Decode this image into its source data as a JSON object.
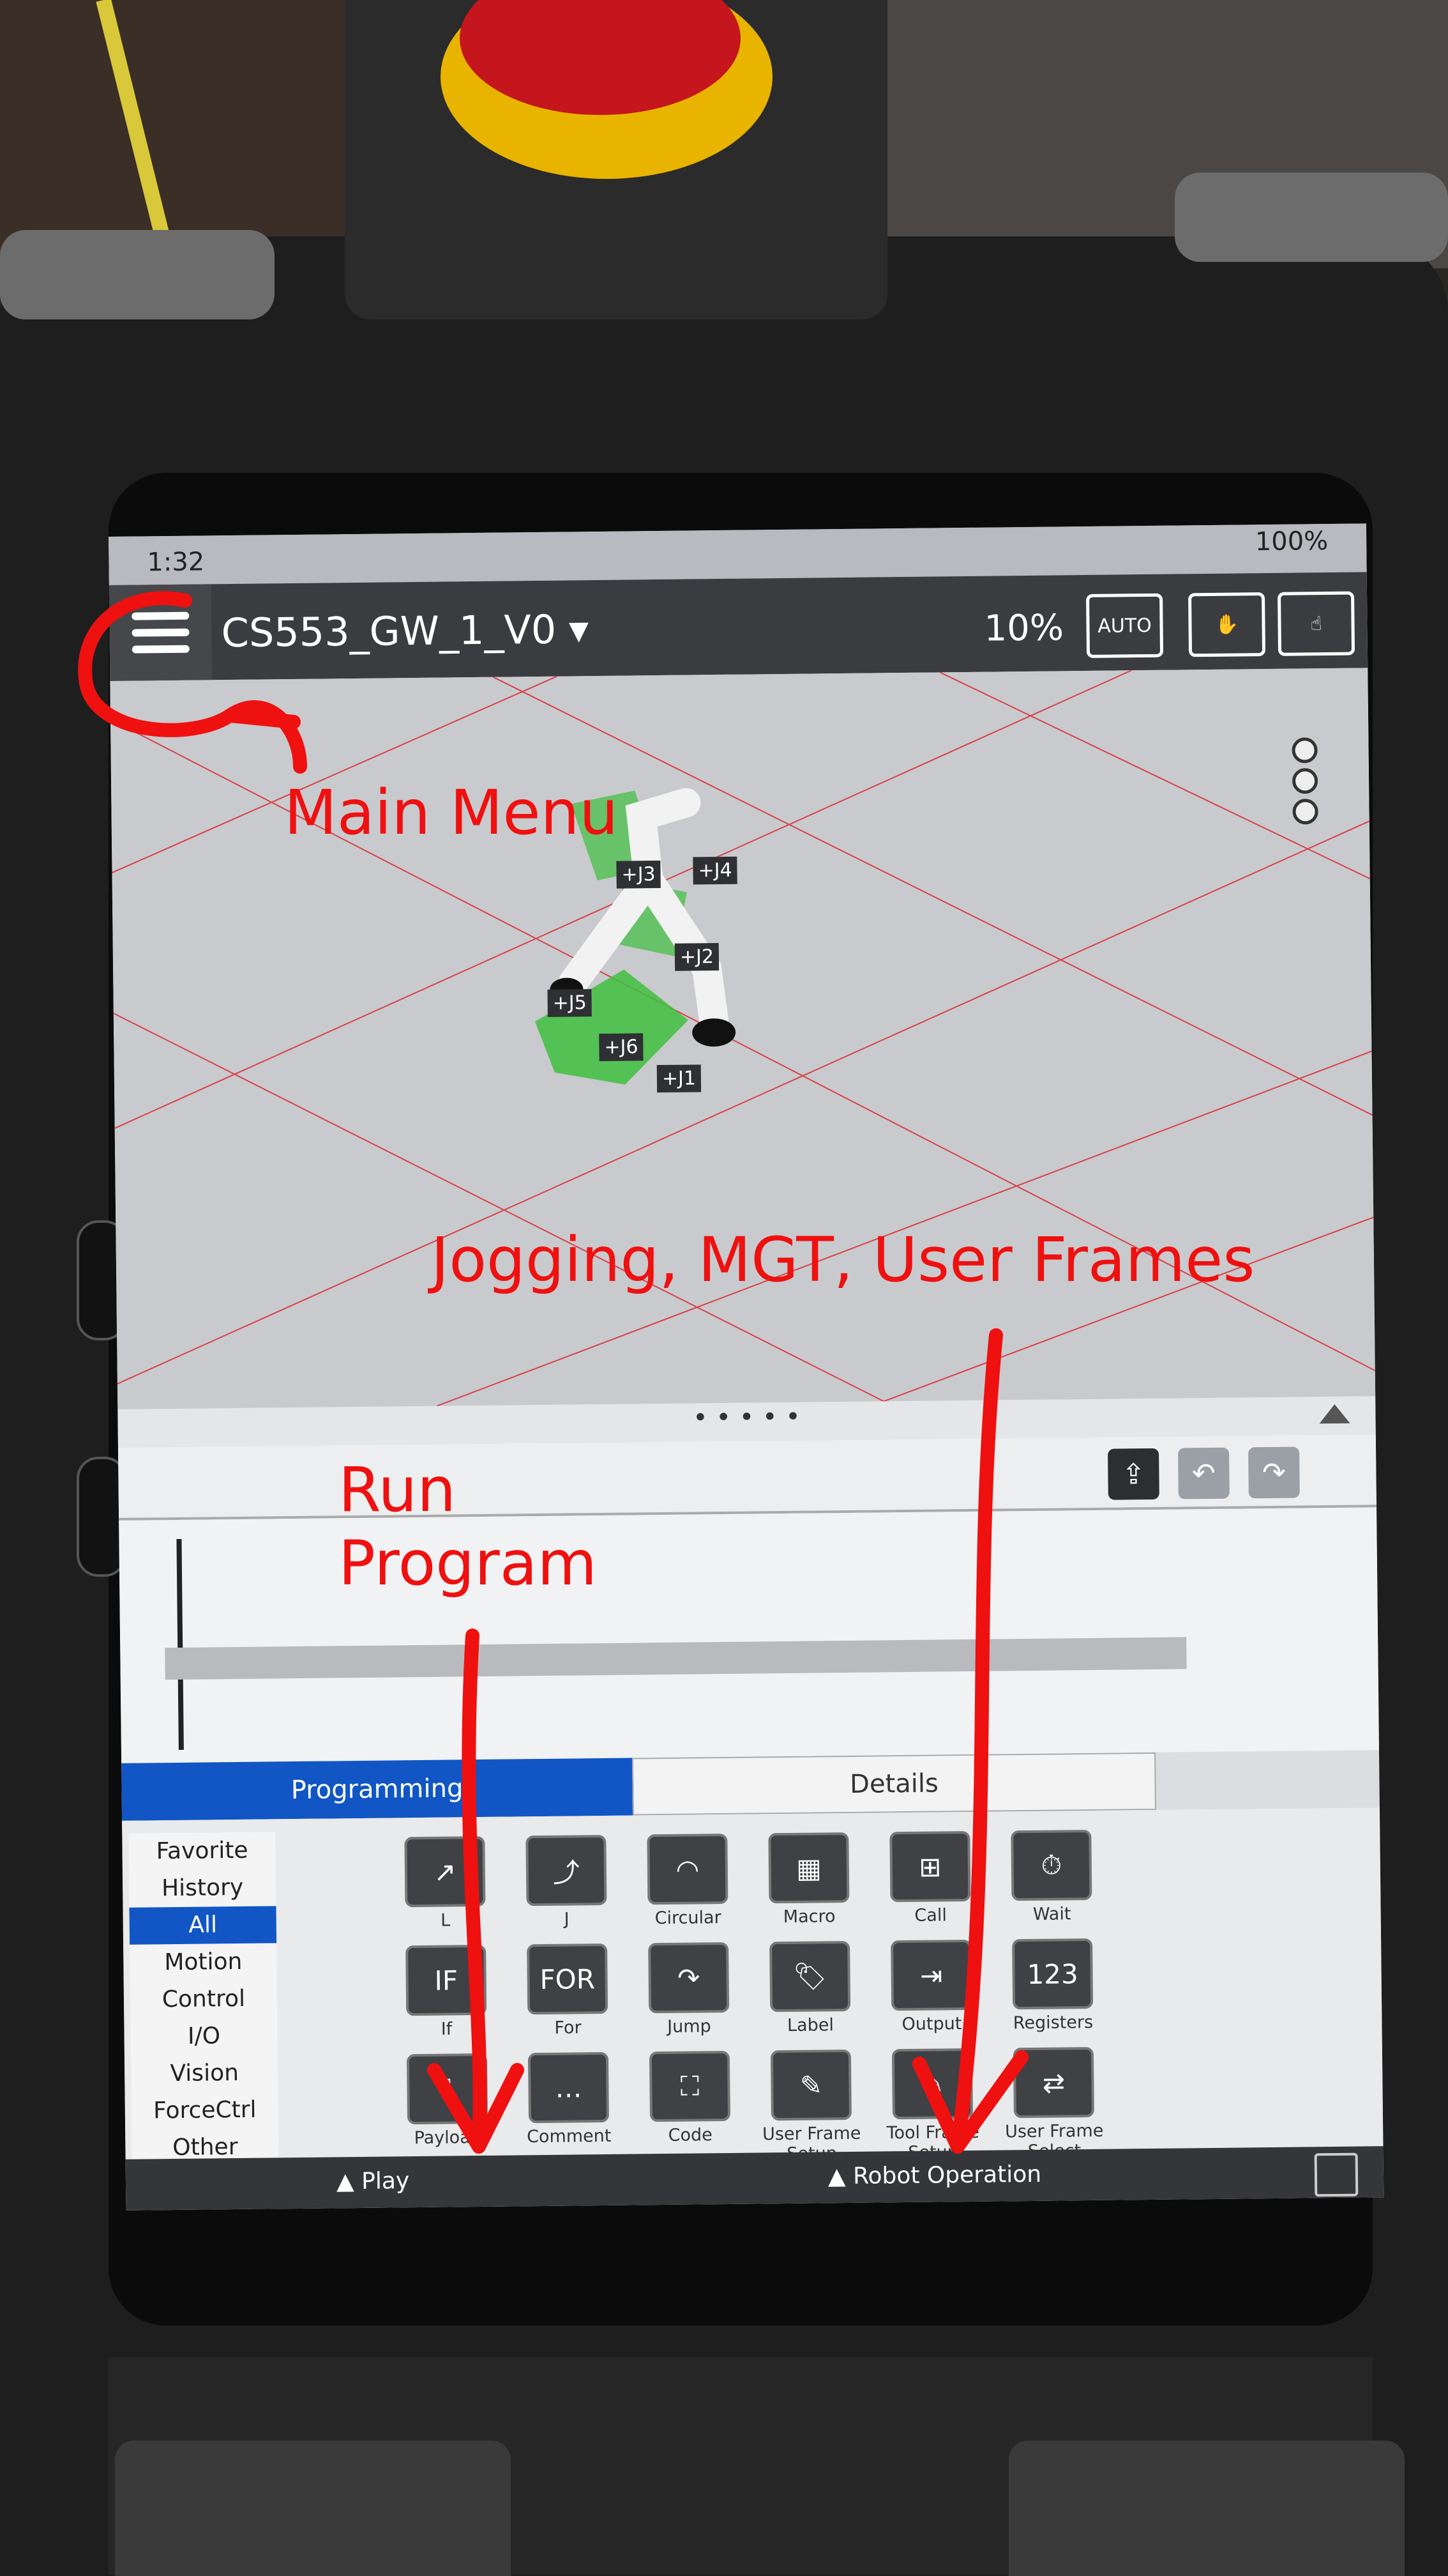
{
  "status_bar": {
    "time": "1:32",
    "battery": "100%"
  },
  "top_bar": {
    "program_title": "CS553_GW_1_V0",
    "speed": "10%",
    "auto_label": "AUTO"
  },
  "joint_labels": [
    "+J3",
    "+J4",
    "+J2",
    "+J5",
    "+J6",
    "+J1"
  ],
  "editor_tabs": {
    "programming": "Programming",
    "details": "Details"
  },
  "categories": [
    "Favorite",
    "History",
    "All",
    "Motion",
    "Control",
    "I/O",
    "Vision",
    "ForceCtrl",
    "Other"
  ],
  "commands": [
    {
      "label": "L",
      "icon": "linear-move-icon",
      "glyph": "↗"
    },
    {
      "label": "J",
      "icon": "joint-move-icon",
      "glyph": "⤴"
    },
    {
      "label": "Circular",
      "icon": "circular-move-icon",
      "glyph": "◠"
    },
    {
      "label": "Macro",
      "icon": "macro-icon",
      "glyph": "▦"
    },
    {
      "label": "Call",
      "icon": "call-icon",
      "glyph": "⊞"
    },
    {
      "label": "Wait",
      "icon": "stopwatch-icon",
      "glyph": "⏱"
    },
    {
      "label": "If",
      "icon": "if-icon",
      "glyph": "IF"
    },
    {
      "label": "For",
      "icon": "for-icon",
      "glyph": "FOR"
    },
    {
      "label": "Jump",
      "icon": "jump-icon",
      "glyph": "↷"
    },
    {
      "label": "Label",
      "icon": "tag-icon",
      "glyph": "🏷"
    },
    {
      "label": "Output",
      "icon": "output-icon",
      "glyph": "⇥"
    },
    {
      "label": "Registers",
      "icon": "registers-icon",
      "glyph": "123"
    },
    {
      "label": "Payload",
      "icon": "payload-icon",
      "glyph": "⇩"
    },
    {
      "label": "Comment",
      "icon": "comment-icon",
      "glyph": "…"
    },
    {
      "label": "Code",
      "icon": "code-icon",
      "glyph": "⛶"
    },
    {
      "label": "User Frame Setup",
      "icon": "user-frame-setup-icon",
      "glyph": "✎"
    },
    {
      "label": "Tool Frame Setup",
      "icon": "tool-frame-setup-icon",
      "glyph": "✎"
    },
    {
      "label": "User Frame Select",
      "icon": "user-frame-select-icon",
      "glyph": "⇄"
    }
  ],
  "bottom_bar": {
    "play": "▲ Play",
    "robot_operation": "▲ Robot Operation"
  },
  "annotations": {
    "main_menu": "Main Menu",
    "jogging": "Jogging, MGT, User Frames",
    "run_line1": "Run",
    "run_line2": "Program"
  },
  "colors": {
    "annotation_red": "#ef1010",
    "accent_blue": "#1156c4",
    "toolbar_dark": "#3b3c40"
  }
}
